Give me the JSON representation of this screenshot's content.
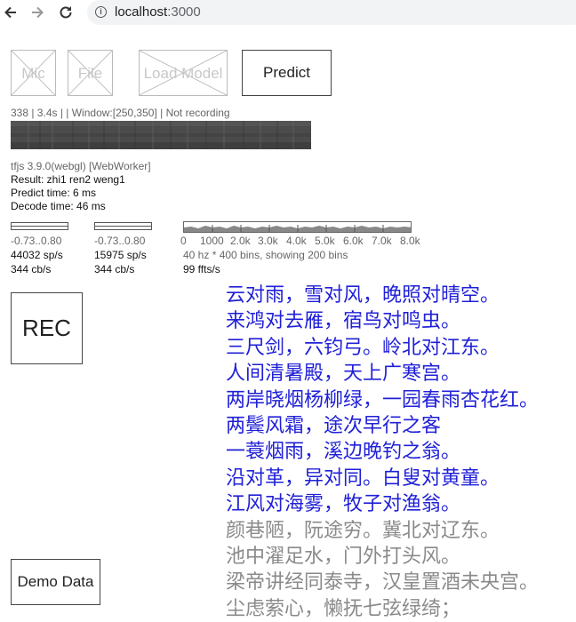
{
  "browser": {
    "back_icon": "arrow-left-icon",
    "forward_icon": "arrow-right-icon",
    "reload_icon": "reload-icon",
    "url_host": "localhost",
    "url_port": ":3000"
  },
  "buttons": {
    "mic": "Mic",
    "file": "File",
    "load_model": "Load Model",
    "predict": "Predict",
    "rec": "REC",
    "demo": "Demo Data"
  },
  "status": {
    "line": "338 | 3.4s | | Window:[250,350] | Not recording",
    "tfjs": "tfjs 3.9.0(webgl) [WebWorker]",
    "result": "Result: zhi1 ren2 weng1",
    "predict_time": "Predict time: 6 ms",
    "decode_time": "Decode time: 46 ms"
  },
  "meters": [
    {
      "range": "-0.73..0.80",
      "rate": "44032 sp/s",
      "cb": "344 cb/s"
    },
    {
      "range": "-0.73..0.80",
      "rate": "15975 sp/s",
      "cb": "344 cb/s"
    }
  ],
  "fft": {
    "ticks": [
      "0",
      "1000",
      "2.0k",
      "3.0k",
      "4.0k",
      "5.0k",
      "6.0k",
      "7.0k",
      "8.0k"
    ],
    "info": "40 hz * 400 bins, showing 200 bins",
    "rate": "99 ffts/s"
  },
  "poem": {
    "recognized": [
      "云对雨，雪对风，晚照对晴空。",
      "来鸿对去雁，宿鸟对鸣虫。",
      "三尺剑，六钧弓。岭北对江东。",
      "人间清暑殿，天上广寒宫。",
      "两岸晓烟杨柳绿，一园春雨杏花红。",
      "两鬓风霜，途次早行之客",
      "一蓑烟雨，溪边晚钓之翁。",
      "沿对革，异对同。白叟对黄童。",
      "江风对海雾，牧子对渔翁。"
    ],
    "pending": [
      "颜巷陋，阮途穷。冀北对辽东。",
      "池中濯足水，门外打头风。",
      "梁帝讲经同泰寺，汉皇置酒未央宫。",
      "尘虑萦心，懒抚七弦绿绮；"
    ]
  }
}
